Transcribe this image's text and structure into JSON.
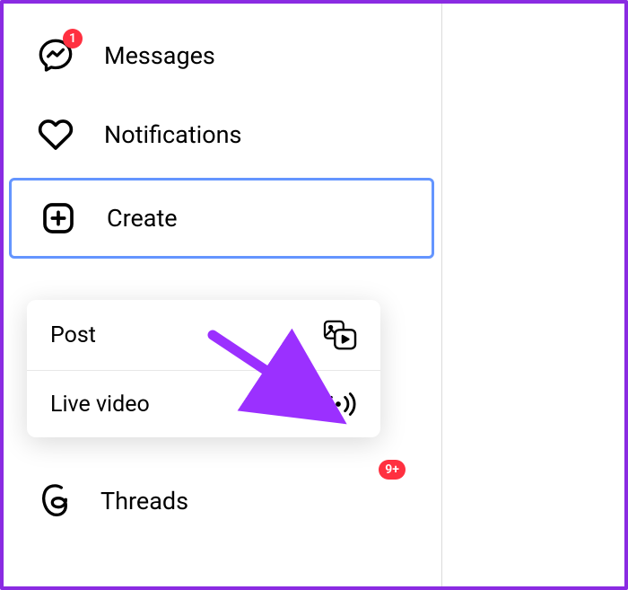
{
  "sidebar": {
    "items": [
      {
        "label": "Messages",
        "badge": "1"
      },
      {
        "label": "Notifications"
      },
      {
        "label": "Create"
      },
      {
        "label": "Threads",
        "badge": "9+"
      }
    ]
  },
  "createMenu": {
    "items": [
      {
        "label": "Post"
      },
      {
        "label": "Live video"
      }
    ]
  },
  "colors": {
    "accent": "#8a2be2",
    "highlight": "#6495ff",
    "badge": "#ff3040"
  }
}
